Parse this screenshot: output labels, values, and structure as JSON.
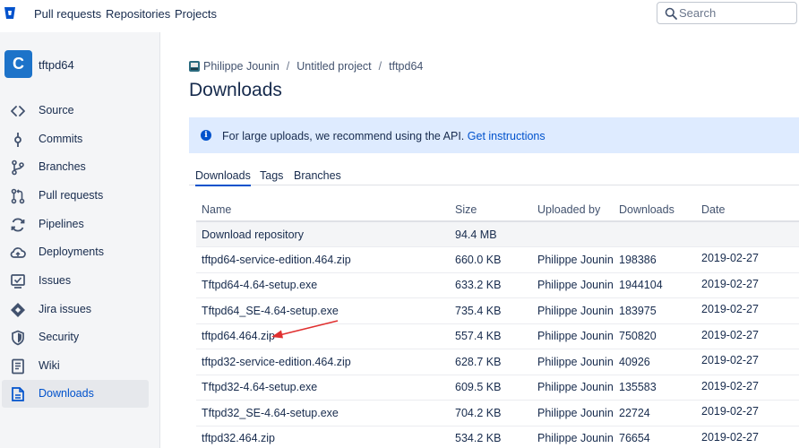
{
  "topnav": {
    "logo_icon": "bitbucket-logo-icon",
    "links": [
      "Pull requests",
      "Repositories",
      "Projects"
    ],
    "search_placeholder": "Search"
  },
  "sidebar": {
    "repo_initial": "C",
    "repo_name": "tftpd64",
    "items": [
      {
        "label": "Source",
        "icon": "code-icon"
      },
      {
        "label": "Commits",
        "icon": "commit-icon"
      },
      {
        "label": "Branches",
        "icon": "branches-icon"
      },
      {
        "label": "Pull requests",
        "icon": "pull-request-icon"
      },
      {
        "label": "Pipelines",
        "icon": "pipelines-icon"
      },
      {
        "label": "Deployments",
        "icon": "deployments-icon"
      },
      {
        "label": "Issues",
        "icon": "issues-icon"
      },
      {
        "label": "Jira issues",
        "icon": "jira-icon"
      },
      {
        "label": "Security",
        "icon": "shield-icon"
      },
      {
        "label": "Wiki",
        "icon": "wiki-icon"
      },
      {
        "label": "Downloads",
        "icon": "downloads-icon",
        "active": true
      }
    ]
  },
  "breadcrumb": {
    "owner": "Philippe Jounin",
    "project": "Untitled project",
    "repo": "tftpd64",
    "separator": "/"
  },
  "page": {
    "title": "Downloads"
  },
  "banner": {
    "text": "For large uploads, we recommend using the API.",
    "link": "Get instructions"
  },
  "tabs": [
    "Downloads",
    "Tags",
    "Branches"
  ],
  "table": {
    "headers": [
      "Name",
      "Size",
      "Uploaded by",
      "Downloads",
      "Date"
    ],
    "repo_row": {
      "name": "Download repository",
      "size": "94.4 MB"
    },
    "rows": [
      {
        "name": "tftpd64-service-edition.464.zip",
        "size": "660.0 KB",
        "uploader": "Philippe Jounin",
        "downloads": "198386",
        "date": "2019-02-27"
      },
      {
        "name": "Tftpd64-4.64-setup.exe",
        "size": "633.2 KB",
        "uploader": "Philippe Jounin",
        "downloads": "1944104",
        "date": "2019-02-27"
      },
      {
        "name": "Tftpd64_SE-4.64-setup.exe",
        "size": "735.4 KB",
        "uploader": "Philippe Jounin",
        "downloads": "183975",
        "date": "2019-02-27"
      },
      {
        "name": "tftpd64.464.zip",
        "size": "557.4 KB",
        "uploader": "Philippe Jounin",
        "downloads": "750820",
        "date": "2019-02-27"
      },
      {
        "name": "tftpd32-service-edition.464.zip",
        "size": "628.7 KB",
        "uploader": "Philippe Jounin",
        "downloads": "40926",
        "date": "2019-02-27"
      },
      {
        "name": "Tftpd32-4.64-setup.exe",
        "size": "609.5 KB",
        "uploader": "Philippe Jounin",
        "downloads": "135583",
        "date": "2019-02-27"
      },
      {
        "name": "Tftpd32_SE-4.64-setup.exe",
        "size": "704.2 KB",
        "uploader": "Philippe Jounin",
        "downloads": "22724",
        "date": "2019-02-27"
      },
      {
        "name": "tftpd32.464.zip",
        "size": "534.2 KB",
        "uploader": "Philippe Jounin",
        "downloads": "76654",
        "date": "2019-02-27"
      }
    ]
  },
  "colors": {
    "accent": "#0052cc",
    "banner_bg": "#deebff",
    "sidebar_bg": "#f4f5f7",
    "annotation_arrow": "#e03030"
  }
}
